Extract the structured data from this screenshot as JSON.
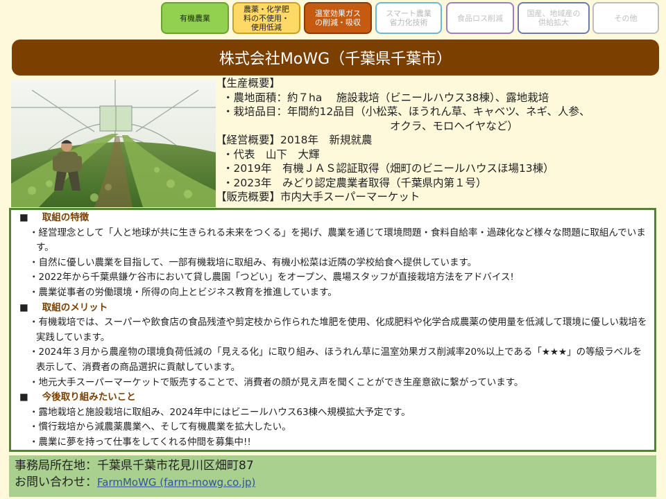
{
  "tags": [
    {
      "label": "有機農業"
    },
    {
      "label": "農薬・化学肥\n料の不使用・\n使用低減"
    },
    {
      "label": "温室効果ガス\nの削減・吸収"
    },
    {
      "label": "スマート農業\n省力化技術"
    },
    {
      "label": "食品ロス削減"
    },
    {
      "label": "国産、地域産の\n供給拡大"
    },
    {
      "label": "その他"
    }
  ],
  "title": "株式会社MoWG（千葉県千葉市）",
  "overview": {
    "production_head": "【生産概要】",
    "production_lines": [
      "・農地面積：約７ha　 施設栽培（ビニールハウス38棟）、露地栽培",
      "・栽培品目：年間約12品目（小松菜、ほうれん草、キャベツ、ネギ、人参、",
      "オクラ、モロヘイヤなど）"
    ],
    "management_head": "【経営概要】2018年　新規就農",
    "management_lines": [
      "・代表　山下　大輝",
      "・2019年　有機ＪＡＳ認証取得（畑町のビニールハウスほ場13棟）",
      "・2023年　みどり認定農業者取得（千葉県内第１号）"
    ],
    "sales": "【販売概要】市内大手スーパーマーケット"
  },
  "sections": [
    {
      "heading": "取組の特徴",
      "bullets": [
        "・経営理念として「人と地球が共に生きられる未来をつくる」を掲げ、農業を通じて環境問題・食料自給率・過疎化など様々な問題に取組んでいます。",
        "・自然に優しい農業を目指して、一部有機栽培に取組み、有機小松菜は近隣の学校給食へ提供しています。",
        "・2022年から千葉県鎌ケ谷市において貸し農園「つどい」をオープン、農場スタッフが直接栽培方法をアドバイス!",
        "・農業従事者の労働環境・所得の向上とビジネス教育を推進しています。"
      ]
    },
    {
      "heading": "取組のメリット",
      "bullets": [
        "・有機栽培では、スーパーや飲食店の食品残渣や剪定枝から作られた堆肥を使用、化成肥料や化学合成農薬の使用量を低減して環境に優しい栽培を実践しています。",
        "・2024年３月から農産物の環境負荷低減の「見える化」に取り組み、ほうれん草に温室効果ガス削減率20%以上である「★★★」の等級ラベルを表示して、消費者の商品選択に貢献しています。",
        "・地元大手スーパーマーケットで販売することで、消費者の顔が見え声を聞くことができ生産意欲に繋がっています。"
      ]
    },
    {
      "heading": "今後取り組みたいこと",
      "bullets": [
        "・露地栽培と施設栽培に取組み、2024年中にはビニールハウス63棟へ規模拡大予定です。",
        "・慣行栽培から減農薬農業へ、そして有機農業を拡大したい。",
        "・農業に夢を持って仕事をしてくれる仲間を募集中!!"
      ]
    }
  ],
  "footer": {
    "address_label": "事務局所在地：千葉県千葉市花見川区畑町87",
    "contact_label": "お問い合わせ：",
    "contact_link": "FarmMoWG (farm-mowg.co.jp)"
  }
}
